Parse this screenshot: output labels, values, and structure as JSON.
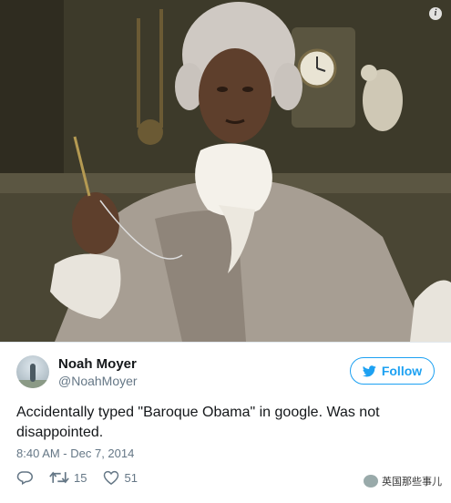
{
  "tweet": {
    "author_name": "Noah Moyer",
    "author_handle": "@NoahMoyer",
    "follow_label": "Follow",
    "text": "Accidentally typed \"Baroque Obama\" in google. Was not disappointed.",
    "timestamp": "8:40 AM - Dec 7, 2014",
    "reply_icon": "reply-icon",
    "retweet_count": "15",
    "like_count": "51"
  },
  "photo": {
    "info_icon": "i"
  },
  "watermark": {
    "text": "英国那些事儿"
  },
  "colors": {
    "accent": "#1da1f2",
    "secondary_text": "#657786",
    "primary_text": "#14171a"
  }
}
